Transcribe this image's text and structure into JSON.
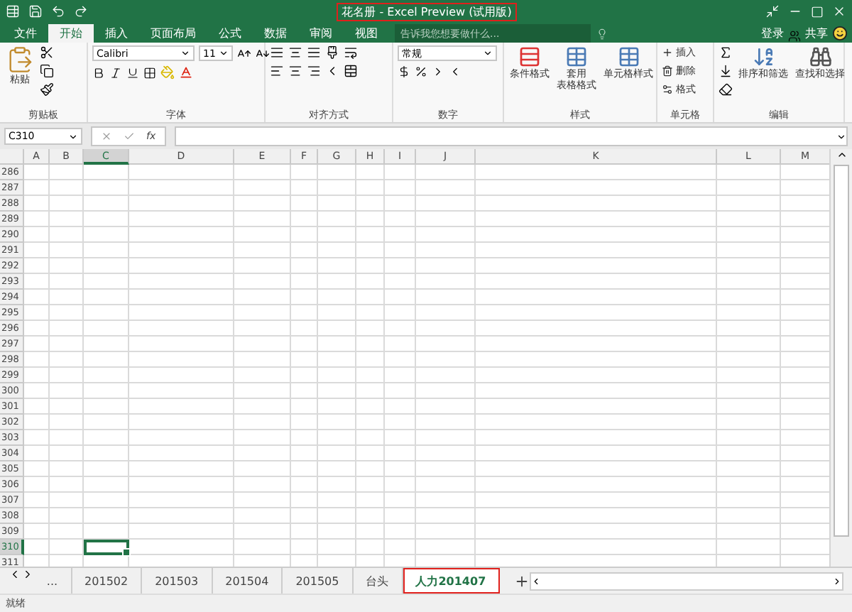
{
  "window": {
    "title": "花名册 - Excel Preview (试用版)",
    "title_annotated": true
  },
  "ribbon_tabs": [
    {
      "label": "文件",
      "selected": false
    },
    {
      "label": "开始",
      "selected": true
    },
    {
      "label": "插入",
      "selected": false
    },
    {
      "label": "页面布局",
      "selected": false
    },
    {
      "label": "公式",
      "selected": false
    },
    {
      "label": "数据",
      "selected": false
    },
    {
      "label": "审阅",
      "selected": false
    },
    {
      "label": "视图",
      "selected": false
    }
  ],
  "tell_me": {
    "placeholder": "告诉我您想要做什么..."
  },
  "account": {
    "sign_in": "登录",
    "share": "共享"
  },
  "groups": {
    "clipboard": {
      "label": "剪贴板",
      "paste": "粘贴"
    },
    "font": {
      "label": "字体",
      "font": "Calibri",
      "size": "11"
    },
    "alignment": {
      "label": "对齐方式"
    },
    "number": {
      "label": "数字",
      "format": "常规"
    },
    "styles": {
      "label": "样式",
      "buttons": [
        [
          "条件格式"
        ],
        [
          "套用",
          "表格格式"
        ],
        [
          "单元格样式"
        ]
      ]
    },
    "cells": {
      "label": "单元格",
      "buttons": [
        "插入",
        "删除",
        "格式"
      ]
    },
    "editing": {
      "label": "编辑",
      "buttons": [
        "排序和筛选",
        "查找和选择"
      ]
    }
  },
  "name_box": "C310",
  "function_button": "fx",
  "columns": [
    {
      "label": "A",
      "selected": false
    },
    {
      "label": "B",
      "selected": false
    },
    {
      "label": "C",
      "selected": true
    },
    {
      "label": "D",
      "selected": false
    },
    {
      "label": "E",
      "selected": false
    },
    {
      "label": "F",
      "selected": false
    },
    {
      "label": "G",
      "selected": false
    },
    {
      "label": "H",
      "selected": false
    },
    {
      "label": "I",
      "selected": false
    },
    {
      "label": "J",
      "selected": false
    },
    {
      "label": "K",
      "selected": false
    },
    {
      "label": "L",
      "selected": false
    },
    {
      "label": "M",
      "selected": false
    }
  ],
  "rows": [
    {
      "label": "286",
      "selected": false
    },
    {
      "label": "287",
      "selected": false
    },
    {
      "label": "288",
      "selected": false
    },
    {
      "label": "289",
      "selected": false
    },
    {
      "label": "290",
      "selected": false
    },
    {
      "label": "291",
      "selected": false
    },
    {
      "label": "292",
      "selected": false
    },
    {
      "label": "293",
      "selected": false
    },
    {
      "label": "294",
      "selected": false
    },
    {
      "label": "295",
      "selected": false
    },
    {
      "label": "296",
      "selected": false
    },
    {
      "label": "297",
      "selected": false
    },
    {
      "label": "298",
      "selected": false
    },
    {
      "label": "299",
      "selected": false
    },
    {
      "label": "300",
      "selected": false
    },
    {
      "label": "301",
      "selected": false
    },
    {
      "label": "302",
      "selected": false
    },
    {
      "label": "303",
      "selected": false
    },
    {
      "label": "304",
      "selected": false
    },
    {
      "label": "305",
      "selected": false
    },
    {
      "label": "306",
      "selected": false
    },
    {
      "label": "307",
      "selected": false
    },
    {
      "label": "308",
      "selected": false
    },
    {
      "label": "309",
      "selected": false
    },
    {
      "label": "310",
      "selected": true
    },
    {
      "label": "311",
      "selected": false
    }
  ],
  "sheet_tabs": [
    {
      "label": "...",
      "selected": false,
      "annotated": false
    },
    {
      "label": "201502",
      "selected": false,
      "annotated": false
    },
    {
      "label": "201503",
      "selected": false,
      "annotated": false
    },
    {
      "label": "201504",
      "selected": false,
      "annotated": false
    },
    {
      "label": "201505",
      "selected": false,
      "annotated": false
    },
    {
      "label": "台头",
      "selected": false,
      "annotated": false
    },
    {
      "label": "人力201407",
      "selected": true,
      "annotated": true
    }
  ],
  "status_bar": {
    "text": "就绪"
  }
}
